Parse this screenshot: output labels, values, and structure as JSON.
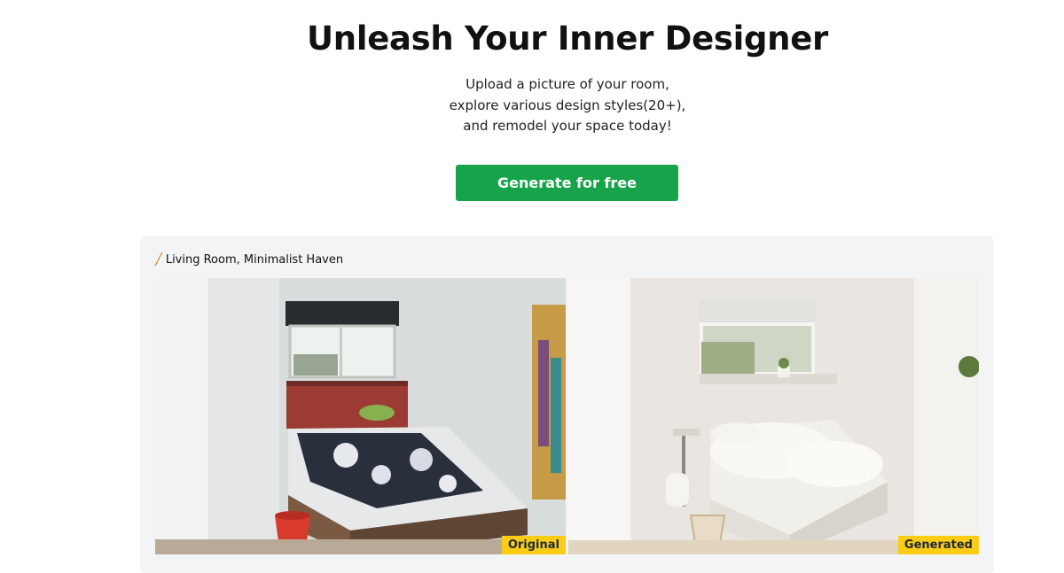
{
  "hero": {
    "title": "Unleash Your Inner Designer",
    "subtitle_lines": [
      "Upload a picture of your room,",
      "explore various design styles(20+),",
      "and remodel your space today!"
    ],
    "cta_label": "Generate for free"
  },
  "showcase": {
    "caption_icon": "magic-wand-icon",
    "caption": "Living Room, Minimalist Haven",
    "original_label": "Original",
    "generated_label": "Generated"
  },
  "colors": {
    "cta": "#16a34a",
    "tag": "#facc15",
    "panel": "#f3f4f6"
  }
}
